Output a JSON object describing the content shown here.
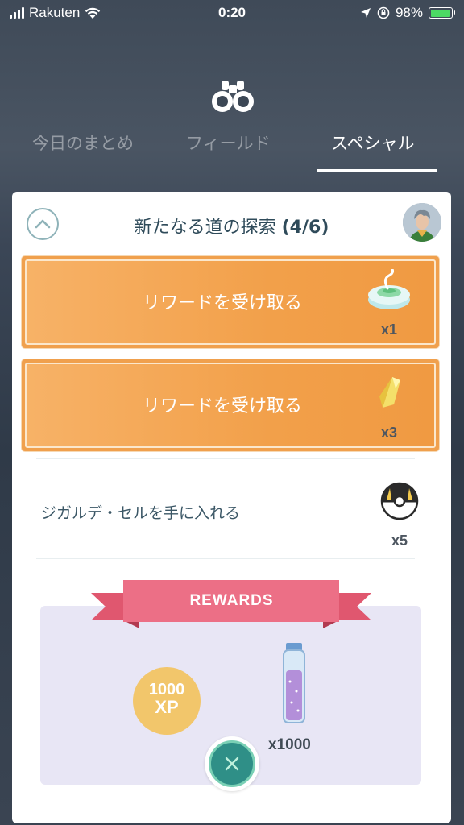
{
  "status_bar": {
    "carrier": "Rakuten",
    "time": "0:20",
    "battery_percent": "98%",
    "battery_level": 0.98
  },
  "tabs": [
    {
      "label": "今日のまとめ",
      "active": false
    },
    {
      "label": "フィールド",
      "active": false
    },
    {
      "label": "スペシャル",
      "active": true
    }
  ],
  "card": {
    "title": "新たなる道の探索",
    "progress": "(4/6)",
    "tasks": [
      {
        "label": "リワードを受け取る",
        "item_icon": "incense-icon",
        "quantity": "x1",
        "completed": true
      },
      {
        "label": "リワードを受け取る",
        "item_icon": "star-piece-icon",
        "quantity": "x3",
        "completed": true
      },
      {
        "label": "ジガルデ・セルを手に入れる",
        "item_icon": "ultra-ball-icon",
        "quantity": "x5",
        "completed": false
      }
    ],
    "rewards": {
      "banner": "REWARDS",
      "xp_amount": "1000",
      "xp_unit": "XP",
      "stardust_quantity": "x1000"
    }
  },
  "colors": {
    "reward_button": "#f0a04d",
    "ribbon": "#ec6f86",
    "rewards_panel": "#e8e6f5",
    "xp_badge": "#f2c66b",
    "close_button": "#2f8f87"
  }
}
